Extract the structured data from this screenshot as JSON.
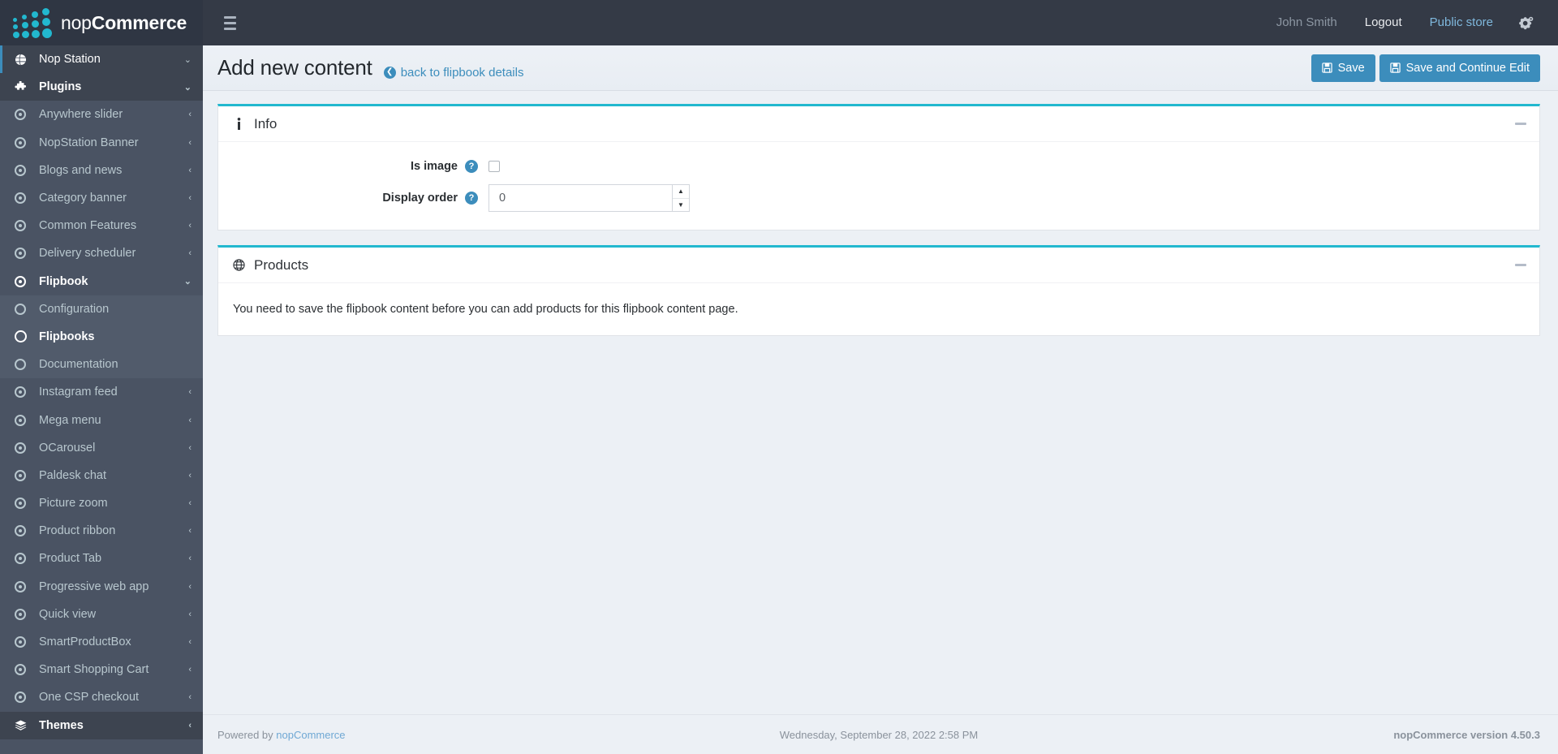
{
  "brand": {
    "name_light": "nop",
    "name_bold": "Commerce"
  },
  "topbar": {
    "hamburger": "menu-icon",
    "user": "John Smith",
    "logout": "Logout",
    "public_store": "Public store",
    "gear": "gears-icon"
  },
  "page": {
    "title": "Add new content",
    "back_link": "back to flipbook details",
    "save": "Save",
    "save_continue": "Save and Continue Edit"
  },
  "sidebar": {
    "items": [
      {
        "label": "Nop Station",
        "icon": "globe-icon",
        "state": "active-top",
        "caret": "⌄",
        "level": "top"
      },
      {
        "label": "Plugins",
        "icon": "puzzle-icon",
        "state": "header",
        "caret": "⌄",
        "level": "top"
      },
      {
        "label": "Anywhere slider",
        "icon": "circle-dot-icon",
        "state": "normal",
        "caret": "‹",
        "level": "sub"
      },
      {
        "label": "NopStation Banner",
        "icon": "circle-dot-icon",
        "state": "normal",
        "caret": "‹",
        "level": "sub"
      },
      {
        "label": "Blogs and news",
        "icon": "circle-dot-icon",
        "state": "normal",
        "caret": "‹",
        "level": "sub"
      },
      {
        "label": "Category banner",
        "icon": "circle-dot-icon",
        "state": "normal",
        "caret": "‹",
        "level": "sub"
      },
      {
        "label": "Common Features",
        "icon": "circle-dot-icon",
        "state": "normal",
        "caret": "‹",
        "level": "sub"
      },
      {
        "label": "Delivery scheduler",
        "icon": "circle-dot-icon",
        "state": "normal",
        "caret": "‹",
        "level": "sub"
      },
      {
        "label": "Flipbook",
        "icon": "circle-dot-icon",
        "state": "bold",
        "caret": "⌄",
        "level": "sub"
      },
      {
        "label": "Configuration",
        "icon": "circle-open-icon",
        "state": "alt",
        "caret": "",
        "level": "sub2"
      },
      {
        "label": "Flipbooks",
        "icon": "circle-open-icon",
        "state": "alt-bold",
        "caret": "",
        "level": "sub2"
      },
      {
        "label": "Documentation",
        "icon": "circle-open-icon",
        "state": "alt",
        "caret": "",
        "level": "sub2"
      },
      {
        "label": "Instagram feed",
        "icon": "circle-dot-icon",
        "state": "normal",
        "caret": "‹",
        "level": "sub"
      },
      {
        "label": "Mega menu",
        "icon": "circle-dot-icon",
        "state": "normal",
        "caret": "‹",
        "level": "sub"
      },
      {
        "label": "OCarousel",
        "icon": "circle-dot-icon",
        "state": "normal",
        "caret": "‹",
        "level": "sub"
      },
      {
        "label": "Paldesk chat",
        "icon": "circle-dot-icon",
        "state": "normal",
        "caret": "‹",
        "level": "sub"
      },
      {
        "label": "Picture zoom",
        "icon": "circle-dot-icon",
        "state": "normal",
        "caret": "‹",
        "level": "sub"
      },
      {
        "label": "Product ribbon",
        "icon": "circle-dot-icon",
        "state": "normal",
        "caret": "‹",
        "level": "sub"
      },
      {
        "label": "Product Tab",
        "icon": "circle-dot-icon",
        "state": "normal",
        "caret": "‹",
        "level": "sub"
      },
      {
        "label": "Progressive web app",
        "icon": "circle-dot-icon",
        "state": "normal",
        "caret": "‹",
        "level": "sub"
      },
      {
        "label": "Quick view",
        "icon": "circle-dot-icon",
        "state": "normal",
        "caret": "‹",
        "level": "sub"
      },
      {
        "label": "SmartProductBox",
        "icon": "circle-dot-icon",
        "state": "normal",
        "caret": "‹",
        "level": "sub"
      },
      {
        "label": "Smart Shopping Cart",
        "icon": "circle-dot-icon",
        "state": "normal",
        "caret": "‹",
        "level": "sub"
      },
      {
        "label": "One CSP checkout",
        "icon": "circle-dot-icon",
        "state": "normal",
        "caret": "‹",
        "level": "sub"
      },
      {
        "label": "Themes",
        "icon": "layers-icon",
        "state": "header",
        "caret": "‹",
        "level": "top"
      }
    ]
  },
  "info_panel": {
    "title": "Info",
    "icon": "info-icon",
    "is_image_label": "Is image",
    "is_image_checked": false,
    "display_order_label": "Display order",
    "display_order_value": "0"
  },
  "products_panel": {
    "title": "Products",
    "icon": "globe-icon",
    "message": "You need to save the flipbook content before you can add products for this flipbook content page."
  },
  "footer": {
    "powered_by": "Powered by ",
    "powered_link": "nopCommerce",
    "date": "Wednesday, September 28, 2022 2:58 PM",
    "version": "nopCommerce version 4.50.3"
  },
  "colors": {
    "accent": "#3c8dbc",
    "panel_top": "#22b8cf",
    "sidebar_bg": "#4a5363",
    "topbar_bg": "#343a46"
  }
}
